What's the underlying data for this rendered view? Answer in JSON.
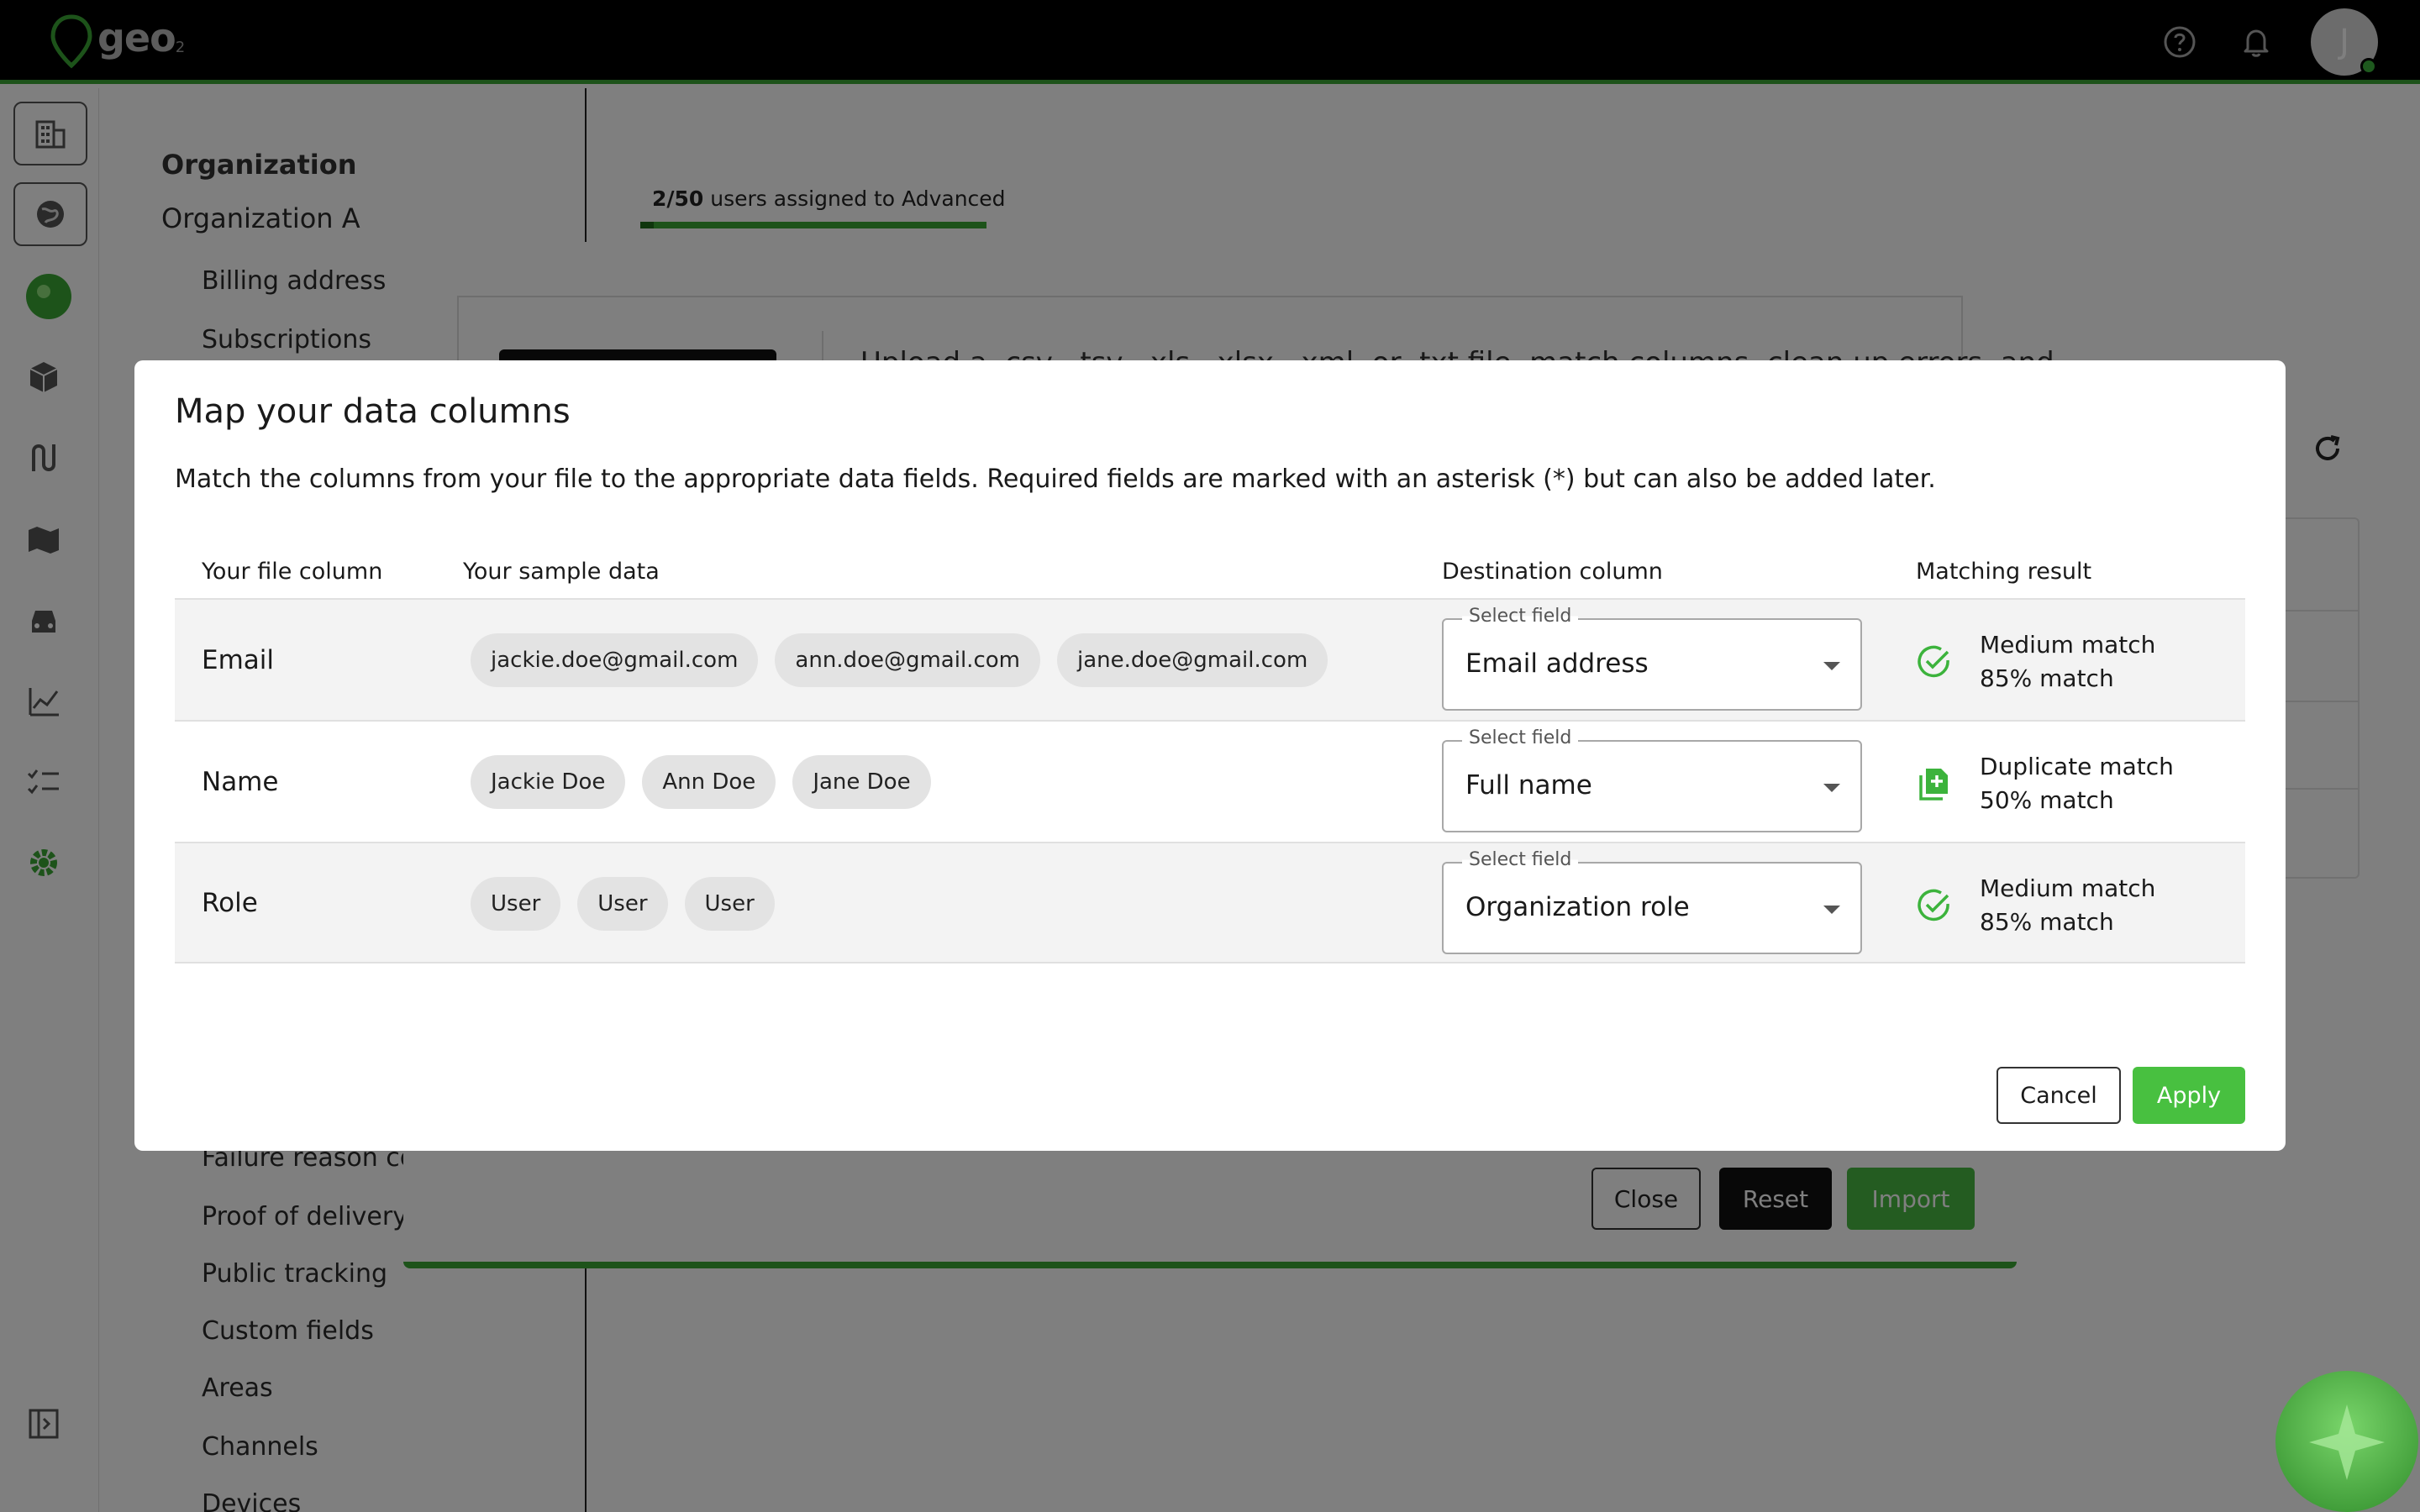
{
  "app": {
    "logo_text": "geo",
    "logo_subscript": "2",
    "user_initial": "J"
  },
  "settings_nav": {
    "section_label": "Organization",
    "org_name": "Organization A",
    "items_top": [
      "Billing address",
      "Subscriptions"
    ],
    "items_bottom": [
      "Failure reason co",
      "Proof of delivery",
      "Public tracking",
      "Custom fields",
      "Areas",
      "Channels",
      "Devices"
    ]
  },
  "license": {
    "assigned": "2/50",
    "text": "users assigned to Advanced",
    "fraction": 0.04
  },
  "import_modal": {
    "description": "Upload a .csv, .tsv, .xls, .xlsx, .xml, or .txt file, match columns, clean up errors, and",
    "close_label": "Close",
    "reset_label": "Reset",
    "import_label": "Import"
  },
  "mapping_modal": {
    "title": "Map your data columns",
    "subtitle": "Match the columns from your file to the appropriate data fields. Required fields are marked with an asterisk (*) but can also be added later.",
    "headers": {
      "file_column": "Your file column",
      "sample_data": "Your sample data",
      "destination": "Destination column",
      "result": "Matching result"
    },
    "rows": [
      {
        "column": "Email",
        "samples": [
          "jackie.doe@gmail.com",
          "ann.doe@gmail.com",
          "jane.doe@gmail.com"
        ],
        "select_label": "Select field",
        "destination": "Email address",
        "match_type": "Medium match",
        "match_percent": "85% match",
        "match_icon": "check-circle-icon"
      },
      {
        "column": "Name",
        "samples": [
          "Jackie Doe",
          "Ann Doe",
          "Jane Doe"
        ],
        "select_label": "Select field",
        "destination": "Full name",
        "match_type": "Duplicate match",
        "match_percent": "50% match",
        "match_icon": "duplicate-doc-icon"
      },
      {
        "column": "Role",
        "samples": [
          "User",
          "User",
          "User"
        ],
        "select_label": "Select field",
        "destination": "Organization role",
        "match_type": "Medium match",
        "match_percent": "85% match",
        "match_icon": "check-circle-icon"
      }
    ],
    "cancel_label": "Cancel",
    "apply_label": "Apply"
  },
  "colors": {
    "brand_green": "#3aa635",
    "apply_green": "#48c040",
    "match_green": "#3cb33c"
  }
}
